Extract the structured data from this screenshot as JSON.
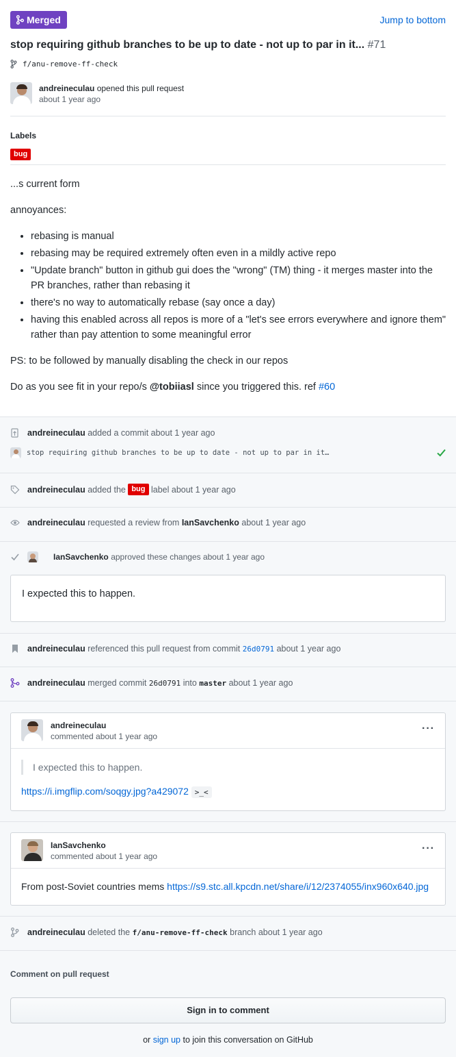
{
  "header": {
    "status_label": "Merged",
    "jump_label": "Jump to bottom",
    "title": "stop requiring github branches to be up to date - not up to par in it...",
    "number": "#71",
    "branch": "f/anu-remove-ff-check"
  },
  "opener": {
    "user": "andreineculau",
    "action": "opened this pull request",
    "time": "about 1 year ago"
  },
  "labels": {
    "heading": "Labels",
    "items": [
      "bug"
    ]
  },
  "description": {
    "p1": "...s current form",
    "p2": "annoyances:",
    "bullets": [
      "rebasing is manual",
      "rebasing may be required extremely often even in a mildly active repo",
      "\"Update branch\" button in github gui does the \"wrong\" (TM) thing - it merges master into the PR branches, rather than rebasing it",
      "there's no way to automatically rebase (say once a day)",
      "having this enabled across all repos is more of a \"let's see errors everywhere and ignore them\" rather than pay attention to some meaningful error"
    ],
    "p3": "PS: to be followed by manually disabling the check in our repos",
    "p4_pre": "Do as you see fit in your repo/s ",
    "p4_mention": "@tobiiasl",
    "p4_mid": " since you triggered this. ref ",
    "p4_ref": "#60"
  },
  "timeline": {
    "commit_added": {
      "user": "andreineculau",
      "text": "added a commit about 1 year ago"
    },
    "commit_msg": "stop requiring github branches to be up to date - not up to par in it…",
    "label_added": {
      "user": "andreineculau",
      "pre": "added the",
      "label": "bug",
      "post": "label about 1 year ago"
    },
    "review_requested": {
      "user": "andreineculau",
      "pre": "requested a review from",
      "reviewer": "IanSavchenko",
      "post": "about 1 year ago"
    },
    "approved": {
      "user": "IanSavchenko",
      "text": "approved these changes about 1 year ago"
    },
    "review_comment": "I expected this to happen.",
    "referenced": {
      "user": "andreineculau",
      "pre": "referenced this pull request from commit",
      "sha": "26d0791",
      "post": "about 1 year ago"
    },
    "merged": {
      "user": "andreineculau",
      "pre": "merged commit",
      "sha": "26d0791",
      "mid": "into",
      "base": "master",
      "post": "about 1 year ago"
    },
    "comment1": {
      "user": "andreineculau",
      "time": "commented about 1 year ago",
      "quote": "I expected this to happen.",
      "link": "https://i.imgflip.com/soqgy.jpg?a429072",
      "code": ">_<",
      "menu": "···"
    },
    "comment2": {
      "user": "IanSavchenko",
      "time": "commented about 1 year ago",
      "pre": "From post-Soviet countries mems ",
      "link": "https://s9.stc.all.kpcdn.net/share/i/12/2374055/inx960x640.jpg",
      "menu": "···"
    },
    "deleted": {
      "user": "andreineculau",
      "pre": "deleted the",
      "branch": "f/anu-remove-ff-check",
      "post": "branch about 1 year ago"
    }
  },
  "footer": {
    "comment_heading": "Comment on pull request",
    "signin_label": "Sign in to comment",
    "or": "or ",
    "signup": "sign up",
    "signup_post": " to join this conversation on GitHub"
  },
  "colors": {
    "merged": "#6f42c1",
    "link": "#0366d6",
    "bug_label": "#e00000",
    "check": "#28a745"
  }
}
